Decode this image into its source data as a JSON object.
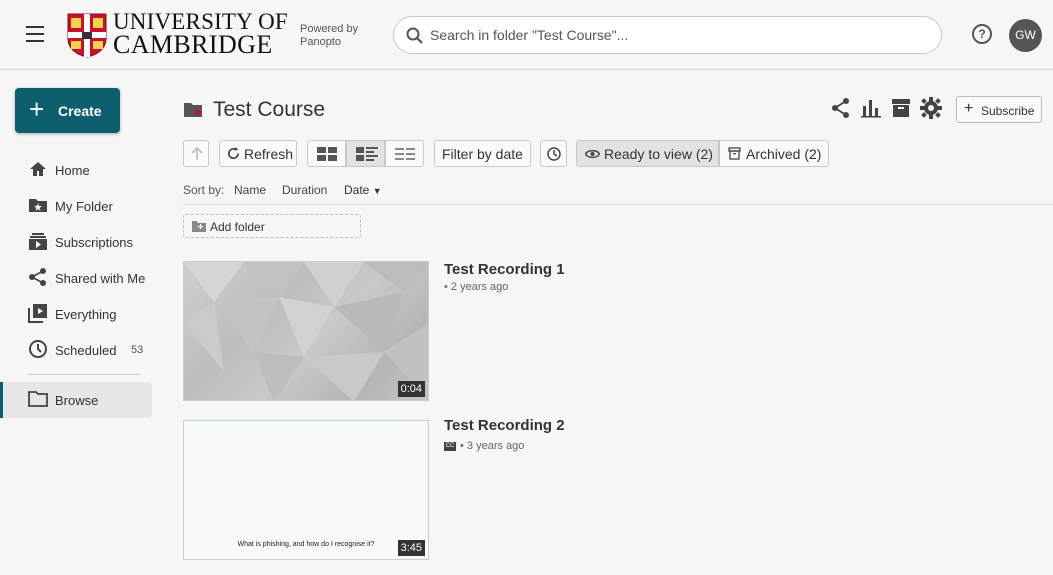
{
  "header": {
    "university_line1": "UNIVERSITY OF",
    "university_line2": "CAMBRIDGE",
    "powered_line1": "Powered by",
    "powered_line2": "Panopto",
    "search_placeholder": "Search in folder \"Test Course\"...",
    "help_label": "?",
    "avatar_initials": "GW"
  },
  "sidebar": {
    "create_label": "Create",
    "items": [
      {
        "label": "Home",
        "icon": "home-icon"
      },
      {
        "label": "My Folder",
        "icon": "star-folder-icon"
      },
      {
        "label": "Subscriptions",
        "icon": "subscriptions-icon"
      },
      {
        "label": "Shared with Me",
        "icon": "share-icon"
      },
      {
        "label": "Everything",
        "icon": "video-library-icon"
      },
      {
        "label": "Scheduled",
        "icon": "clock-icon",
        "count": "53"
      }
    ],
    "browse_label": "Browse"
  },
  "main": {
    "folder_title": "Test Course",
    "subscribe_label": "Subscribe",
    "toolbar": {
      "refresh_label": "Refresh",
      "filter_date_label": "Filter by date",
      "ready_label": "Ready to view (2)",
      "archived_label": "Archived (2)"
    },
    "sort": {
      "prefix": "Sort by:",
      "name": "Name",
      "duration": "Duration",
      "date": "Date"
    },
    "add_folder_label": "Add folder",
    "recordings": [
      {
        "title": "Test Recording 1",
        "meta": "• 2 years ago",
        "duration": "0:04"
      },
      {
        "title": "Test Recording 2",
        "meta": "• 3 years ago",
        "duration": "3:45",
        "thumb_caption": "What is phishing, and how do I recognise it?",
        "cc": "CC"
      }
    ]
  },
  "colors": {
    "accent": "#0e5f6e",
    "crest_red": "#c8102e"
  }
}
